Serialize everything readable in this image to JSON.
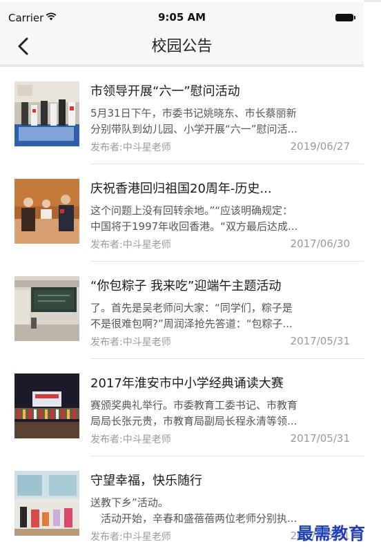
{
  "status_bar": {
    "carrier": "Carrier",
    "time": "9:05 AM"
  },
  "nav": {
    "title": "校园公告",
    "back_icon": "chevron-left-icon"
  },
  "announcements": [
    {
      "title": "市领导开展“六一”慰问活动",
      "excerpt_line1": "5月31日下午，市委书记姚晓东、市长蔡丽新",
      "excerpt_line2": "分别带队到幼儿园、小学开展“六一”慰问活...",
      "author": "发布者:中斗星老师",
      "date": "2019/06/27"
    },
    {
      "title": "庆祝香港回归祖国20周年-历史...",
      "excerpt_line1": "这个问题上没有回转余地。”“应该明确规定：",
      "excerpt_line2": "中国将于1997年收回香港。“双方最后达成...",
      "author": "发布者:中斗星老师",
      "date": "2017/06/30"
    },
    {
      "title": "“你包粽子 我来吃”迎端午主题活动",
      "excerpt_line1": "了。首先是吴老师问大家：“同学们，粽子是",
      "excerpt_line2": "不是很难包啊?”周润泽抢先答道：“包粽子...",
      "author": "发布者:中斗星老师",
      "date": "2017/05/31"
    },
    {
      "title": "2017年淮安市中小学经典诵读大赛",
      "excerpt_line1": "赛颁奖典礼举行。市委教育工委书记、市教育",
      "excerpt_line2": "局局长张元贵，市教育局副局长程永清等领...",
      "author": "发布者:中斗星老师",
      "date": "2017/05/31"
    },
    {
      "title": "守望幸福，快乐随行",
      "excerpt_line1": "送教下乡”活动。",
      "excerpt_line2": "　活动开始，辛春和盛蓓蓓两位老师分别执...",
      "author": "发布者:中斗星老师",
      "date": "2017/05/31"
    }
  ],
  "watermark": "最需教育"
}
